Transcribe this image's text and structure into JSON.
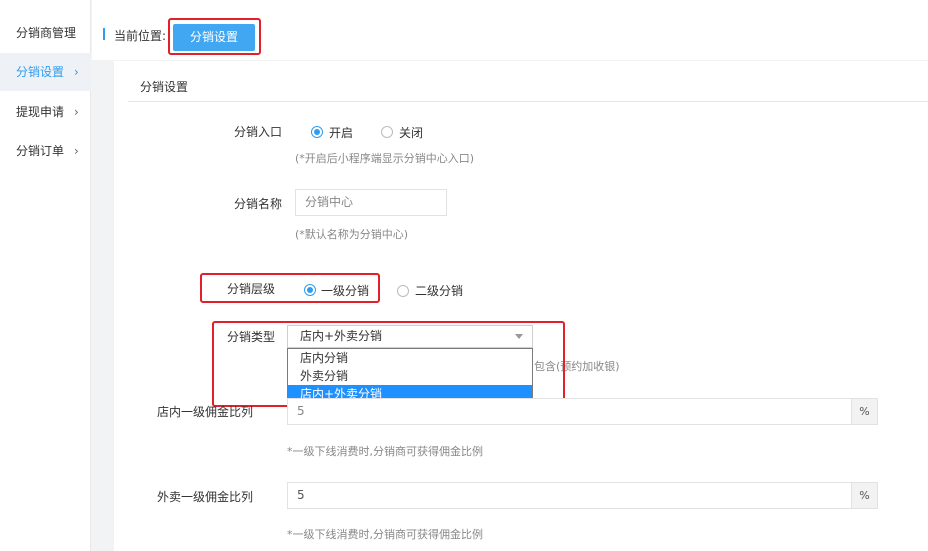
{
  "sidebar": {
    "items": [
      {
        "label": "分销商管理",
        "chevron": ""
      },
      {
        "label": "分销设置",
        "chevron": "›"
      },
      {
        "label": "提现申请",
        "chevron": "›"
      },
      {
        "label": "分销订单",
        "chevron": "›"
      }
    ]
  },
  "breadcrumb": {
    "label": "当前位置:",
    "current": "分销设置"
  },
  "panel": {
    "title": "分销设置"
  },
  "form": {
    "entry": {
      "label": "分销入口",
      "options": [
        "开启",
        "关闭"
      ],
      "selected": "开启",
      "hint": "(*开启后小程序端显示分销中心入口)"
    },
    "name": {
      "label": "分销名称",
      "value": "分销中心",
      "hint": "(*默认名称为分销中心)"
    },
    "level": {
      "label": "分销层级",
      "options": [
        "一级分销",
        "二级分销"
      ],
      "selected": "一级分销"
    },
    "type": {
      "label": "分销类型",
      "selected": "店内+外卖分销",
      "options": [
        "店内分销",
        "外卖分销",
        "店内+外卖分销"
      ],
      "hint_tail": "包含(预约加收银)"
    },
    "store_rate": {
      "label": "店内一级佣金比列",
      "value": "5",
      "suffix": "%",
      "hint": "*一级下线消费时,分销商可获得佣金比例"
    },
    "takeout_rate": {
      "label": "外卖一级佣金比列",
      "value": "5",
      "suffix": "%",
      "hint": "*一级下线消费时,分销商可获得佣金比例"
    }
  },
  "colors": {
    "accent": "#2f9cf0",
    "button": "#41a7f2",
    "highlight_border": "#e0202b",
    "dropdown_selected": "#1e90ff"
  }
}
